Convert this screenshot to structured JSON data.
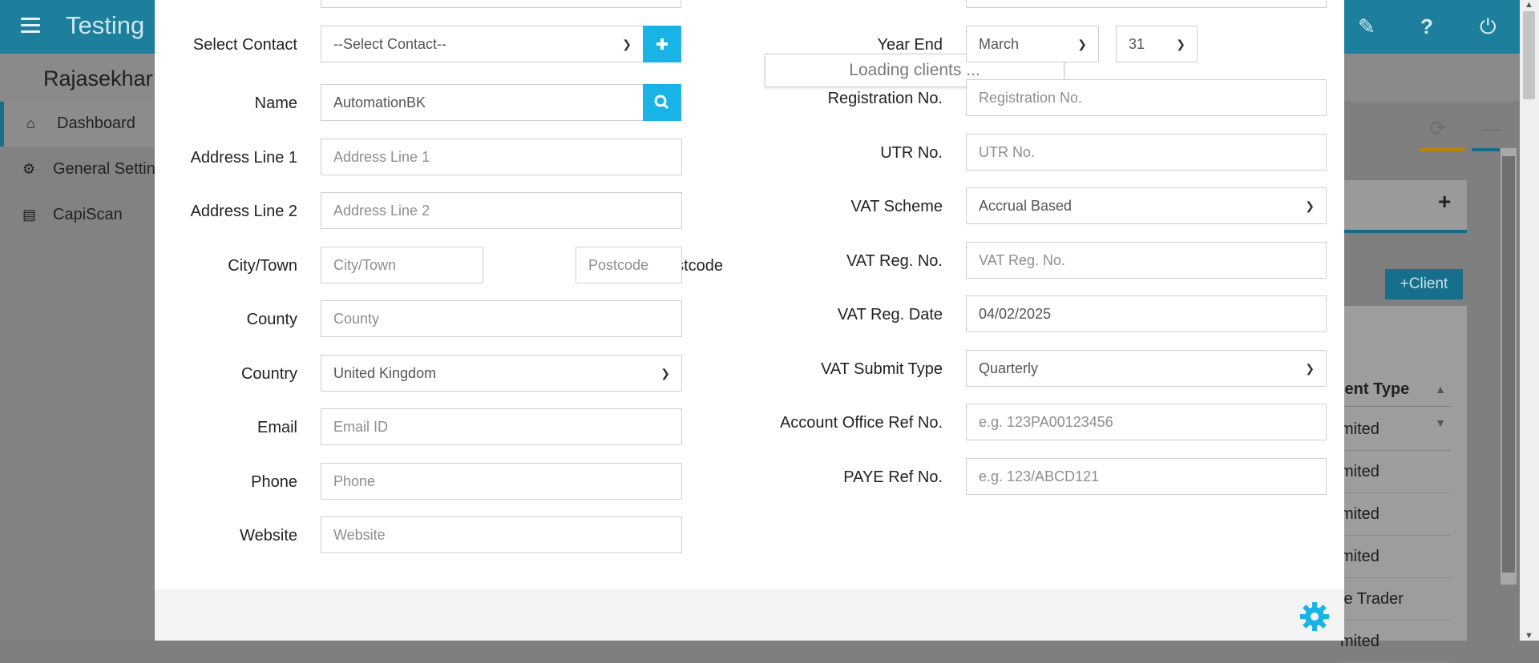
{
  "app": {
    "title": "Testing",
    "user": "Rajasekhar"
  },
  "sidebar": {
    "items": [
      {
        "label": "Dashboard",
        "icon": "home-icon",
        "active": true
      },
      {
        "label": "General Settings",
        "icon": "gears-icon",
        "active": false
      },
      {
        "label": "CapiScan",
        "icon": "scanner-icon",
        "active": false
      }
    ]
  },
  "background_page": {
    "add_client_button": "+Client",
    "table_header": "ient Type",
    "table_rows": [
      "mited",
      "mited",
      "mited",
      "mited",
      "le Trader",
      "mited"
    ]
  },
  "form": {
    "left": {
      "select_contact": {
        "label": "Select Contact",
        "value": "--Select Contact--"
      },
      "loading_tooltip": "Loading clients ...",
      "name": {
        "label": "Name",
        "value": "AutomationBK"
      },
      "address1": {
        "label": "Address Line 1",
        "placeholder": "Address Line 1"
      },
      "address2": {
        "label": "Address Line 2",
        "placeholder": "Address Line 2"
      },
      "city": {
        "label": "City/Town",
        "placeholder": "City/Town"
      },
      "postcode": {
        "label": "Postcode",
        "placeholder": "Postcode"
      },
      "county": {
        "label": "County",
        "placeholder": "County"
      },
      "country": {
        "label": "Country",
        "value": "United Kingdom"
      },
      "email": {
        "label": "Email",
        "placeholder": "Email ID"
      },
      "phone": {
        "label": "Phone",
        "placeholder": "Phone"
      },
      "website": {
        "label": "Website",
        "placeholder": "Website"
      }
    },
    "right": {
      "year_end": {
        "label": "Year End",
        "month": "March",
        "day": "31"
      },
      "registration_no": {
        "label": "Registration No.",
        "placeholder": "Registration No."
      },
      "utr_no": {
        "label": "UTR No.",
        "placeholder": "UTR No."
      },
      "vat_scheme": {
        "label": "VAT Scheme",
        "value": "Accrual Based"
      },
      "vat_reg_no": {
        "label": "VAT Reg. No.",
        "placeholder": "VAT Reg. No."
      },
      "vat_reg_date": {
        "label": "VAT Reg. Date",
        "value": "04/02/2025"
      },
      "vat_submit_type": {
        "label": "VAT Submit Type",
        "value": "Quarterly"
      },
      "account_office_ref": {
        "label": "Account Office Ref No.",
        "placeholder": "e.g. 123PA00123456"
      },
      "paye_ref": {
        "label": "PAYE Ref No.",
        "placeholder": "e.g. 123/ABCD121"
      }
    }
  },
  "colors": {
    "accent": "#1ab3e6",
    "topbar": "#1d7f9c"
  }
}
